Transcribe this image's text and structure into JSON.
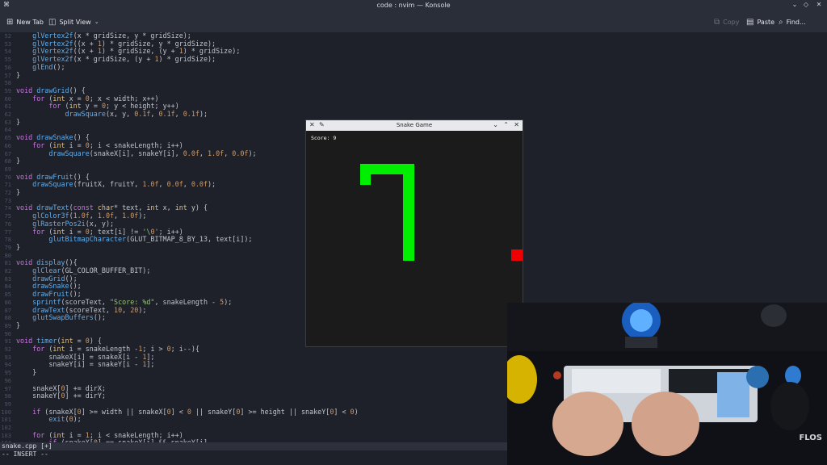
{
  "window": {
    "title": "code : nvim — Konsole",
    "controls": [
      "minimize-icon",
      "maximize-icon",
      "close-icon"
    ]
  },
  "toolbar": {
    "new_tab_label": "New Tab",
    "split_view_label": "Split View",
    "copy_label": "Copy",
    "paste_label": "Paste",
    "find_label": "Find..."
  },
  "editor": {
    "lines": [
      {
        "n": "52",
        "t": "    glVertex2f(x * gridSize, y * gridSize);"
      },
      {
        "n": "53",
        "t": "    glVertex2f((x + 1) * gridSize, y * gridSize);"
      },
      {
        "n": "54",
        "t": "    glVertex2f((x + 1) * gridSize, (y + 1) * gridSize);"
      },
      {
        "n": "55",
        "t": "    glVertex2f(x * gridSize, (y + 1) * gridSize);"
      },
      {
        "n": "56",
        "t": "    glEnd();"
      },
      {
        "n": "57",
        "t": "}"
      },
      {
        "n": "58",
        "t": ""
      },
      {
        "n": "59",
        "t": "void drawGrid() {"
      },
      {
        "n": "60",
        "t": "    for (int x = 0; x < width; x++)"
      },
      {
        "n": "61",
        "t": "        for (int y = 0; y < height; y++)"
      },
      {
        "n": "62",
        "t": "            drawSquare(x, y, 0.1f, 0.1f, 0.1f);"
      },
      {
        "n": "63",
        "t": "}"
      },
      {
        "n": "64",
        "t": ""
      },
      {
        "n": "65",
        "t": "void drawSnake() {"
      },
      {
        "n": "66",
        "t": "    for (int i = 0; i < snakeLength; i++)"
      },
      {
        "n": "67",
        "t": "        drawSquare(snakeX[i], snakeY[i], 0.0f, 1.0f, 0.0f);"
      },
      {
        "n": "68",
        "t": "}"
      },
      {
        "n": "69",
        "t": ""
      },
      {
        "n": "70",
        "t": "void drawFruit() {"
      },
      {
        "n": "71",
        "t": "    drawSquare(fruitX, fruitY, 1.0f, 0.0f, 0.0f);"
      },
      {
        "n": "72",
        "t": "}"
      },
      {
        "n": "73",
        "t": ""
      },
      {
        "n": "74",
        "t": "void drawText(const char* text, int x, int y) {"
      },
      {
        "n": "75",
        "t": "    glColor3f(1.0f, 1.0f, 1.0f);"
      },
      {
        "n": "76",
        "t": "    glRasterPos2i(x, y);"
      },
      {
        "n": "77",
        "t": "    for (int i = 0; text[i] != '\\0'; i++)"
      },
      {
        "n": "78",
        "t": "        glutBitmapCharacter(GLUT_BITMAP_8_BY_13, text[i]);"
      },
      {
        "n": "79",
        "t": "}"
      },
      {
        "n": "80",
        "t": ""
      },
      {
        "n": "81",
        "t": "void display(){"
      },
      {
        "n": "82",
        "t": "    glClear(GL_COLOR_BUFFER_BIT);"
      },
      {
        "n": "83",
        "t": "    drawGrid();"
      },
      {
        "n": "84",
        "t": "    drawSnake();"
      },
      {
        "n": "85",
        "t": "    drawFruit();"
      },
      {
        "n": "86",
        "t": "    sprintf(scoreText, \"Score: %d\", snakeLength - 5);"
      },
      {
        "n": "87",
        "t": "    drawText(scoreText, 10, 20);"
      },
      {
        "n": "88",
        "t": "    glutSwapBuffers();"
      },
      {
        "n": "89",
        "t": "}"
      },
      {
        "n": "90",
        "t": ""
      },
      {
        "n": "91",
        "t": "void timer(int = 0) {"
      },
      {
        "n": "92",
        "t": "    for (int i = snakeLength -1; i > 0; i--){"
      },
      {
        "n": "93",
        "t": "        snakeX[i] = snakeX[i - 1];"
      },
      {
        "n": "94",
        "t": "        snakeY[i] = snakeY[i - 1];"
      },
      {
        "n": "95",
        "t": "    }"
      },
      {
        "n": "96",
        "t": ""
      },
      {
        "n": "97",
        "t": "    snakeX[0] += dirX;"
      },
      {
        "n": "98",
        "t": "    snakeY[0] += dirY;"
      },
      {
        "n": "99",
        "t": ""
      },
      {
        "n": "100",
        "t": "    if (snakeX[0] >= width || snakeX[0] < 0 || snakeY[0] >= height || snakeY[0] < 0)"
      },
      {
        "n": "101",
        "t": "        exit(0);"
      },
      {
        "n": "102",
        "t": ""
      },
      {
        "n": "103",
        "t": "    for (int i = 1; i < snakeLength; i++)"
      },
      {
        "n": "104",
        "t": "        if (snakeX[0] == snakeX[i] && snakeY[i]"
      }
    ],
    "status_file": "snake.cpp [+]",
    "mode": "-- INSERT --"
  },
  "game_window": {
    "title": "Snake Game",
    "score_text": "Score: 9",
    "snake_color": "#00ee00",
    "fruit_color": "#ee0000"
  },
  "webcam": {
    "brand_text": "FLOS"
  }
}
